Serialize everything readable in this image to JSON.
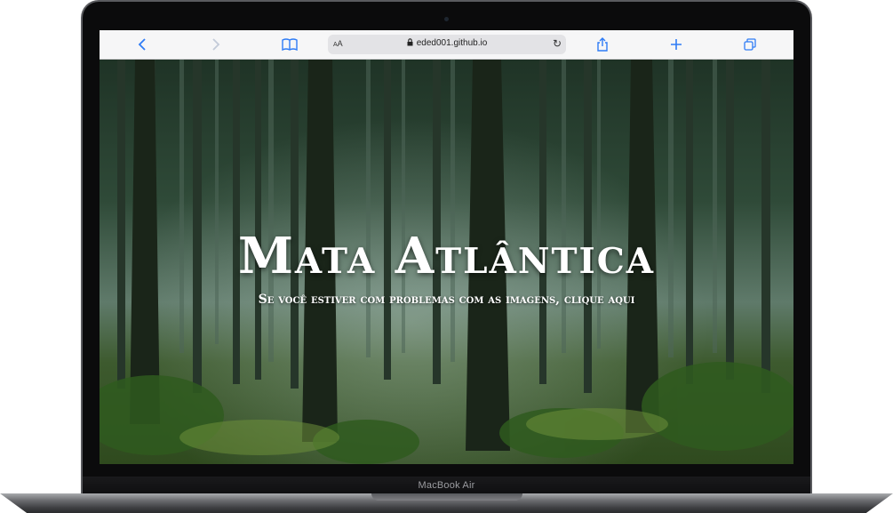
{
  "browser": {
    "text_size_label": "AA",
    "url": "eded001.github.io",
    "accent_color": "#2f7cf6"
  },
  "page": {
    "title": "Mata Atlântica",
    "subtitle": "Se você estiver com problemas com as imagens, clique aqui"
  },
  "device": {
    "model": "MacBook Air"
  },
  "icons": [
    "back-chevron-icon",
    "forward-chevron-icon",
    "bookmarks-icon",
    "lock-icon",
    "reload-icon",
    "share-icon",
    "new-tab-plus-icon",
    "tabs-overview-icon"
  ]
}
